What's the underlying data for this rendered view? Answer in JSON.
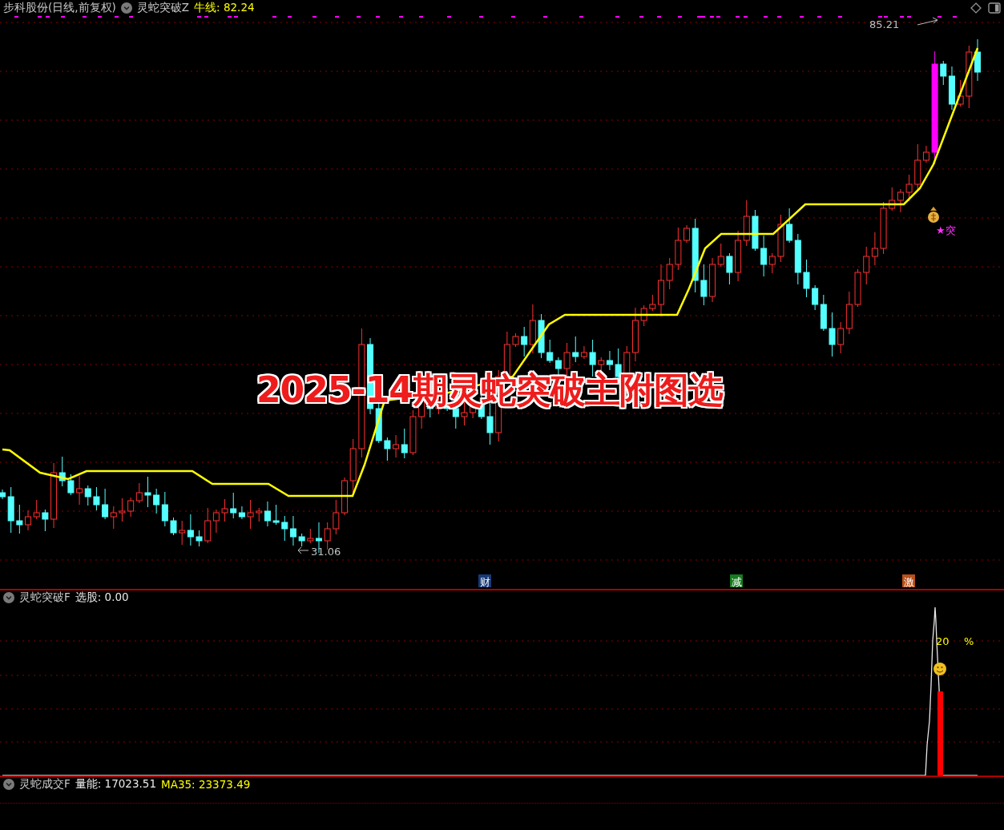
{
  "main_panel": {
    "stock_title": "步科股份(日线,前复权)",
    "indicator_name": "灵蛇突破Z",
    "indicator_value": "牛线: 82.24",
    "high_label": "85.21",
    "low_label": "31.06",
    "signal_label": "★突",
    "markers": [
      {
        "text": "财",
        "color": "#173a78"
      },
      {
        "text": "减",
        "color": "#167a1e"
      },
      {
        "text": "激",
        "color": "#b8501a"
      }
    ]
  },
  "banner_title": "2025-14期灵蛇突破主附图选",
  "signal_panel": {
    "indicator_name": "灵蛇突破F",
    "indicator_value": "选股: 0.00",
    "percent_value": "20",
    "percent_sign": "%"
  },
  "volume_panel": {
    "indicator_name": "灵蛇成交F",
    "volume_value": "量能: 17023.51",
    "ma_value": "MA35: 23373.49"
  }
}
